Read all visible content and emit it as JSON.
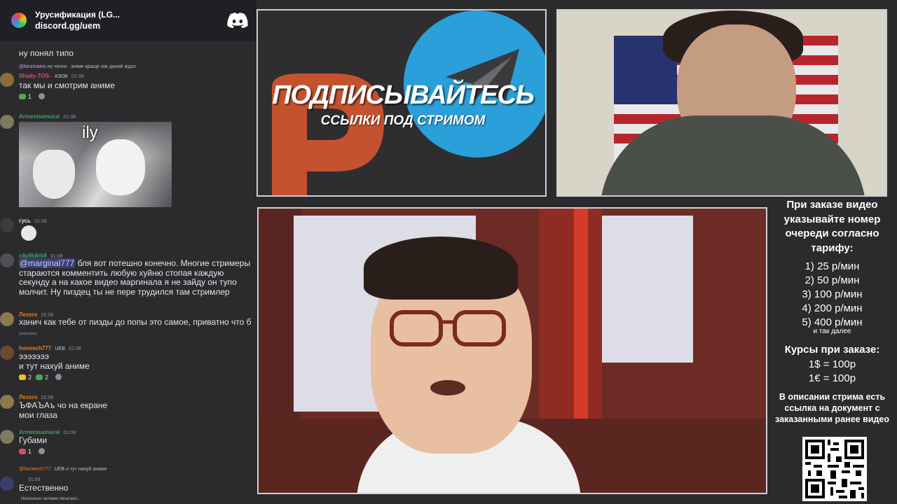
{
  "server": {
    "name": "Урусификация (LG...",
    "invite": "discord.gg/uem"
  },
  "chat": {
    "messages": [
      {
        "partial_text": "ну понял типо"
      },
      {
        "reply_user": "@kirsinrains",
        "reply_text": "ну чесно . аніме краще ніж даний відос",
        "user": "Shady-TOS-",
        "user_color": "#e04e65",
        "badge": "АЗОВ",
        "time": "01:08",
        "text": "так мы и смотрим аниме",
        "reactions": [
          {
            "count": "1",
            "color": "#4ea84a"
          }
        ]
      },
      {
        "user": "Armenisamurai",
        "user_color": "#3aa55c",
        "time": "01:08",
        "image_caption": "ily"
      },
      {
        "user": "гусь",
        "user_color": "#dcddde",
        "time": "01:08"
      },
      {
        "user": "c8p8b8rk8",
        "user_color": "#3ba55c",
        "time": "01:08",
        "mention": "@marginal777",
        "text": " бля вот потешно конечно. Многие стримеры стараются комментить любую хуйню стопая каждую секунду а на какое видео маргинала я не зайду он тупо молчит. Ну пиздец ты не пере трудился там стримлер"
      },
      {
        "user": "Лezero",
        "user_color": "#e67e22",
        "time": "01:08",
        "text": "ханич как тебе от пизды до попы это самое, приватно что б",
        "edited": "(изменено)"
      },
      {
        "user": "honeech777",
        "user_color": "#e67e22",
        "badge": "UEB",
        "time": "01:08",
        "text_line1": "эээээээ",
        "text_line2": "и тут нахуй аниме",
        "reactions": [
          {
            "count": "2",
            "color": "#f1c40f"
          },
          {
            "count": "2",
            "color": "#4ea84a"
          }
        ]
      },
      {
        "user": "Лezero",
        "user_color": "#e67e22",
        "time": "01:08",
        "text_line1": "ЪФАЪАъ чо на екране",
        "text_line2": "мои глаза"
      },
      {
        "user": "Armenisamurai",
        "user_color": "#3aa55c",
        "time": "01:08",
        "text": "Губами",
        "reactions": [
          {
            "count": "1",
            "color": "#e04e65"
          }
        ]
      },
      {
        "reply_user": "@honeech777",
        "reply_badge": "UEB",
        "reply_text": "и тут нахуй аниме",
        "time": "01:08",
        "text": "Естественно"
      }
    ],
    "typing": "Несколько человек печатают..."
  },
  "promo": {
    "title": "ПОДПИСЫВАЙТЕСЬ",
    "subtitle": "ССЫЛКИ ПОД СТРИМОМ",
    "colors": {
      "boosty": "#c5522f",
      "telegram": "#2a9fd9"
    }
  },
  "info": {
    "order_title": "При заказе видео указывайте номер очереди согласно тарифу:",
    "tariffs": [
      "1) 25 р/мин",
      "2) 50 р/мин",
      "3) 100 р/мин",
      "4) 200 р/мин",
      "5) 400 р/мин"
    ],
    "tariff_more": "и так далее",
    "rates_title": "Курсы при заказе:",
    "rate_usd": "1$ = 100р",
    "rate_eur": "1€ = 100р",
    "description_note": "В описании стрима есть ссылка на документ с заказанными ранее видео"
  }
}
